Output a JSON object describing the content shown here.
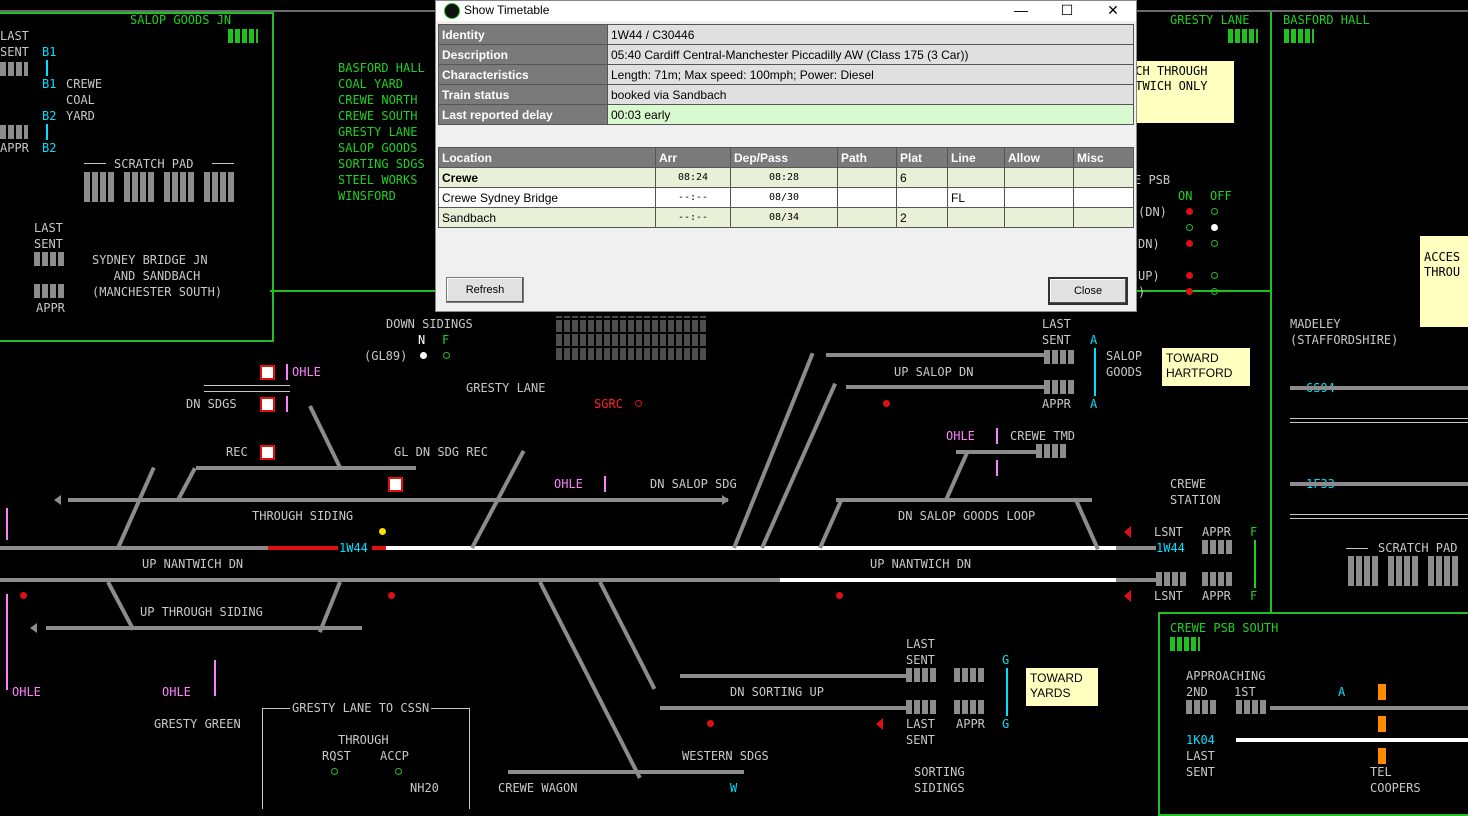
{
  "panel": {
    "areas": {
      "salop_goods_jn": "SALOP GOODS JN",
      "gresty_lane_hdr": "GRESTY LANE",
      "basford_hall_hdr": "BASFORD HALL",
      "crewe_psb_south": "CREWE PSB SOUTH"
    },
    "top_left": {
      "last_sent": "LAST\nSENT",
      "b1a": "B1",
      "b1b": "B1",
      "crewe_coal_yard": "CREWE\nCOAL\nYARD",
      "b2a": "B2",
      "b2b": "B2",
      "appr": "APPR",
      "scratch_pad": "SCRATCH PAD",
      "last_sent2": "LAST\nSENT",
      "sydney": "SYDNEY BRIDGE JN\n   AND SANDBACH\n(MANCHESTER SOUTH)",
      "appr2": "APPR"
    },
    "location_list": [
      "BASFORD HALL",
      "COAL YARD",
      "CREWE NORTH",
      "CREWE SOUTH",
      "GRESTY LANE",
      "SALOP GOODS",
      "SORTING SDGS",
      "STEEL WORKS",
      "WINSFORD"
    ],
    "labels": {
      "down_sidings": "DOWN SIDINGS",
      "n": "N",
      "f": "F",
      "gl89": "(GL89)",
      "ohle": "OHLE",
      "gresty_lane": "GRESTY LANE",
      "sgrc": "SGRC",
      "dn_sdgs": "DN SDGS",
      "rec": "REC",
      "gl_dn_sdg_rec": "GL DN SDG REC",
      "dn_salop_sdg": "DN SALOP SDG",
      "through_siding": "THROUGH SIDING",
      "up_nantwich_dn": "UP NANTWICH DN",
      "up_through_siding": "UP THROUGH SIDING",
      "gresty_green": "GRESTY GREEN",
      "gresty_lane_to_cssn": "GRESTY LANE TO CSSN",
      "through": "THROUGH",
      "rqst": "RQST",
      "accp": "ACCP",
      "nh20": "NH20",
      "western_sdgs": "WESTERN SDGS",
      "crewe_wagon": "CREWE WAGON",
      "sorting_sidings": "SORTING\nSIDINGS",
      "dn_sorting_up": "DN SORTING UP",
      "last_sent": "LAST\nSENT",
      "appr": "APPR",
      "g": "G",
      "w": "W",
      "up_salop_dn": "UP SALOP DN",
      "salop_goods": "SALOP\nGOODS",
      "a": "A",
      "crewe_tmd": "CREWE TMD",
      "dn_salop_goods_loop": "DN SALOP GOODS LOOP",
      "crewe_station": "CREWE\nSTATION",
      "lsnt": "LSNT",
      "ffl": "F",
      "psb": "E PSB",
      "on": "ON",
      "off": "OFF",
      "dn1": "(DN)",
      "dn2": "DN)",
      "up1": "UP)",
      "up2": ")",
      "madeley": "MADELEY\n(STAFFORDSHIRE)",
      "scratch_pad2": "SCRATCH PAD",
      "approaching": "APPROACHING",
      "second": "2ND",
      "first": "1ST",
      "tel": "TEL\nCOOPERS",
      "a_small": "A"
    },
    "headcodes": [
      "1W44",
      "1W44",
      "6S94",
      "1F33",
      "1K04"
    ],
    "notes": {
      "hartford": "TOWARD\nHARTFORD",
      "yards": "TOWARD\nYARDS",
      "through_nantwich": "ACH THROUGH\nNTWICH ONLY",
      "acces": "ACCES\nTHROU"
    }
  },
  "dialog": {
    "title": "Show Timetable",
    "controls": {
      "minimize": "—",
      "maximize": "☐",
      "close": "✕"
    },
    "details": [
      {
        "key": "Identity",
        "value": "1W44 / C30446"
      },
      {
        "key": "Description",
        "value": "05:40 Cardiff Central-Manchester Piccadilly AW (Class 175 (3 Car))"
      },
      {
        "key": "Characteristics",
        "value": "Length: 71m; Max speed: 100mph; Power: Diesel"
      },
      {
        "key": "Train status",
        "value": "booked via Sandbach"
      },
      {
        "key": "Last reported delay",
        "value": "00:03 early"
      }
    ],
    "columns": [
      "Location",
      "Arr",
      "Dep/Pass",
      "Path",
      "Plat",
      "Line",
      "Allow",
      "Misc"
    ],
    "rows": [
      {
        "location": "Crewe",
        "arr": "08:24",
        "dep": "08:28",
        "path": "",
        "plat": "6",
        "line": "",
        "allow": "",
        "misc": ""
      },
      {
        "location": "Crewe Sydney Bridge",
        "arr": "--:--",
        "dep": "08/30",
        "path": "",
        "plat": "",
        "line": "FL",
        "allow": "",
        "misc": ""
      },
      {
        "location": "Sandbach",
        "arr": "--:--",
        "dep": "08/34",
        "path": "",
        "plat": "2",
        "line": "",
        "allow": "",
        "misc": ""
      }
    ],
    "refresh_label": "Refresh",
    "close_label": "Close"
  }
}
